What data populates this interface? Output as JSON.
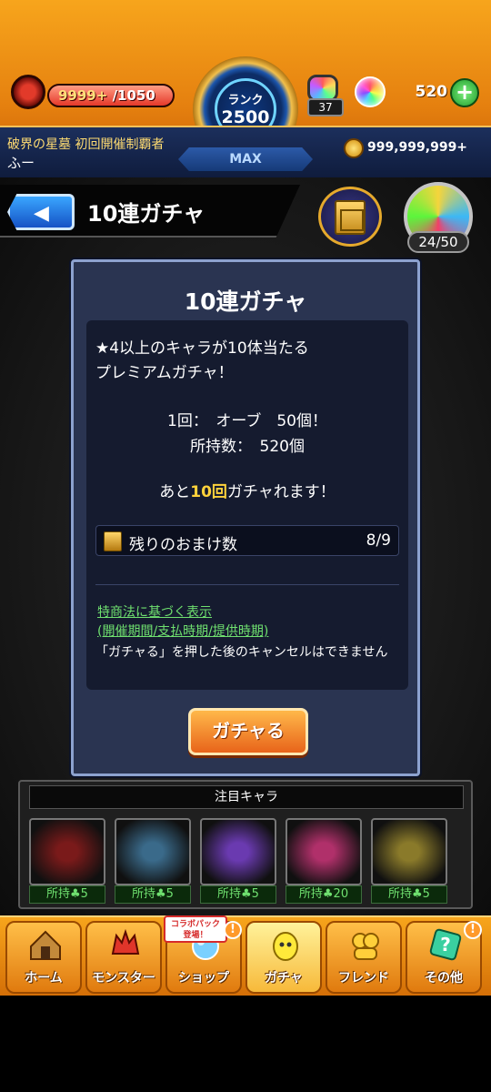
{
  "hud": {
    "hp_current": "9999+",
    "hp_max": "/1050",
    "rank_label": "ランク",
    "rank_value": "2500",
    "rank_max": "MAX",
    "stamina_count": "37",
    "orb_count": "520",
    "player_title": "破界の星墓 初回開催制覇者",
    "player_name": "ふー",
    "gold": "999,999,999+"
  },
  "header": {
    "title": "10連ガチャ",
    "box_count": "24/50"
  },
  "dialog": {
    "title": "10連ガチャ",
    "desc_line1": "★4以上のキャラが10体当たる",
    "desc_line2": "プレミアムガチャ！",
    "cost_line": "1回：　オーブ　50個！",
    "owned_line": "所持数：　520個",
    "remain_prefix": "あと",
    "remain_count": "10回",
    "remain_suffix": "ガチャれます！",
    "bonus_label": "残りのおまけ数",
    "bonus_value": "8/9",
    "legal_link1": "特商法に基づく表示",
    "legal_link2": "(開催期間/支払時期/提供時期)",
    "legal_note": "「ガチャる」を押した後のキャンセルはできません",
    "gacha_button": "ガチャる"
  },
  "featured": {
    "title": "注目キャラ",
    "characters": [
      {
        "label": "所持♣5",
        "color": "#7a1a1a"
      },
      {
        "label": "所持♣5",
        "color": "#3a6a8a"
      },
      {
        "label": "所持♣5",
        "color": "#6a3ab0"
      },
      {
        "label": "所持♣20",
        "color": "#b0306a"
      },
      {
        "label": "所持♣5",
        "color": "#8a7a2a"
      }
    ]
  },
  "nav": {
    "home": "ホーム",
    "monster": "モンスター",
    "shop": "ショップ",
    "gacha": "ガチャ",
    "friend": "フレンド",
    "other": "その他",
    "collab_badge_line1": "コラボパック",
    "collab_badge_line2": "登場！",
    "alert_mark": "!"
  },
  "colors": {
    "accent_orange": "#f7a51c",
    "link_green": "#6fe06f",
    "highlight_yellow": "#ffd23b",
    "dialog_bg": "#2a3451"
  },
  "status": {
    "hp_fraction": 1.0
  }
}
